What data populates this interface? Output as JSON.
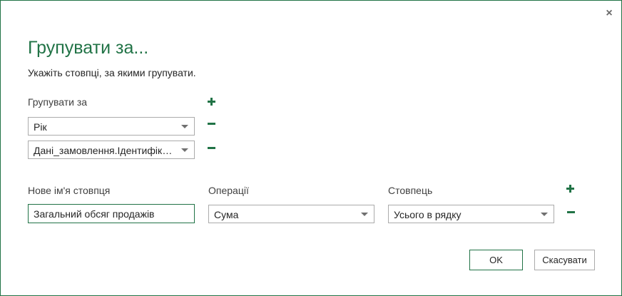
{
  "dialog": {
    "close_glyph": "×",
    "title": "Групувати за...",
    "subtitle": "Укажіть стовпці, за якими групувати."
  },
  "group_by": {
    "label": "Групувати за",
    "columns": [
      {
        "value": "Рік"
      },
      {
        "value": "Дані_замовлення.Ідентифікатор_категорії"
      }
    ]
  },
  "aggregation": {
    "new_column_label": "Нове ім'я стовпця",
    "operation_label": "Операції",
    "column_label": "Стовпець",
    "rows": [
      {
        "new_name": "Загальний обсяг продажів",
        "operation": "Сума",
        "column": "Усього в рядку"
      }
    ]
  },
  "buttons": {
    "ok": "OK",
    "cancel": "Скасувати"
  }
}
